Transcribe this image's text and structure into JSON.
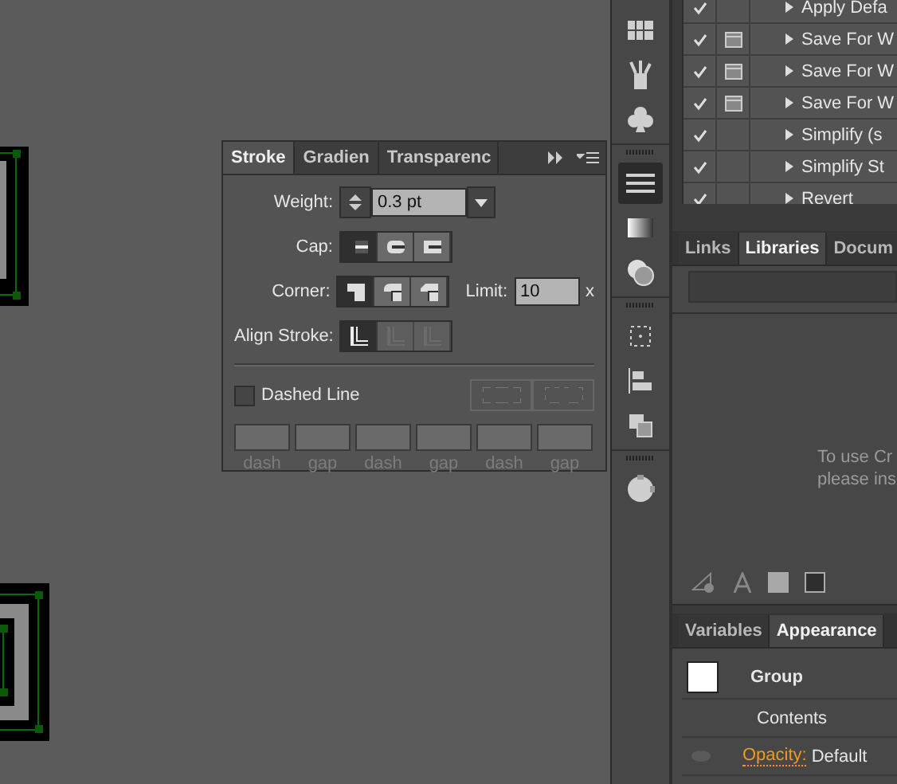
{
  "actions": [
    {
      "checked": true,
      "dialog": false,
      "label": "Apply Defa"
    },
    {
      "checked": true,
      "dialog": true,
      "label": "Save For W"
    },
    {
      "checked": true,
      "dialog": true,
      "label": "Save For W"
    },
    {
      "checked": true,
      "dialog": true,
      "label": "Save For W"
    },
    {
      "checked": true,
      "dialog": false,
      "label": "Simplify (s"
    },
    {
      "checked": true,
      "dialog": false,
      "label": "Simplify St"
    },
    {
      "checked": true,
      "dialog": false,
      "label": "Revert"
    }
  ],
  "dock": [
    {
      "kind": "swatches",
      "selected": false
    },
    {
      "kind": "brushes",
      "selected": false
    },
    {
      "kind": "symbols",
      "selected": false
    },
    {
      "kind": "grip"
    },
    {
      "kind": "stroke",
      "selected": true
    },
    {
      "kind": "gradient",
      "selected": false
    },
    {
      "kind": "transparency",
      "selected": false
    },
    {
      "kind": "grip"
    },
    {
      "kind": "transform",
      "selected": false
    },
    {
      "kind": "align",
      "selected": false
    },
    {
      "kind": "pathfinder",
      "selected": false
    },
    {
      "kind": "grip"
    },
    {
      "kind": "navigator",
      "selected": false
    }
  ],
  "stroke_panel": {
    "tabs": [
      {
        "label": "Stroke",
        "selected": true
      },
      {
        "label": "Gradien",
        "selected": false
      },
      {
        "label": "Transparenc",
        "selected": false
      }
    ],
    "weight": {
      "label": "Weight:",
      "value": "0.3 pt"
    },
    "cap": {
      "label": "Cap:",
      "options": [
        {
          "selected": true
        },
        {
          "selected": false
        },
        {
          "selected": false
        }
      ]
    },
    "corner": {
      "label": "Corner:",
      "options": [
        {
          "selected": true
        },
        {
          "selected": false
        },
        {
          "selected": false
        }
      ]
    },
    "limit": {
      "label": "Limit:",
      "value": "10",
      "unit": "x"
    },
    "align": {
      "label": "Align Stroke:",
      "options": [
        {
          "selected": true,
          "disabled": false
        },
        {
          "selected": false,
          "disabled": true
        },
        {
          "selected": false,
          "disabled": true
        }
      ]
    },
    "dashed": {
      "label": "Dashed Line",
      "checked": false
    },
    "dash_fields": [
      {
        "label": "dash"
      },
      {
        "label": "gap"
      },
      {
        "label": "dash"
      },
      {
        "label": "gap"
      },
      {
        "label": "dash"
      },
      {
        "label": "gap"
      }
    ]
  },
  "libraries": {
    "tabs": [
      {
        "label": "Links",
        "selected": false
      },
      {
        "label": "Libraries",
        "selected": true
      },
      {
        "label": "Docum",
        "selected": false
      }
    ],
    "message": [
      "To use Cr",
      "please ins"
    ]
  },
  "appearance": {
    "tabs": [
      {
        "label": "Variables",
        "selected": false
      },
      {
        "label": "Appearance",
        "selected": true
      }
    ],
    "rows": [
      {
        "kind": "object",
        "label": "Group"
      },
      {
        "kind": "plain",
        "label": "Contents"
      },
      {
        "kind": "attribute",
        "label": "Opacity:",
        "value": "Default"
      }
    ]
  }
}
